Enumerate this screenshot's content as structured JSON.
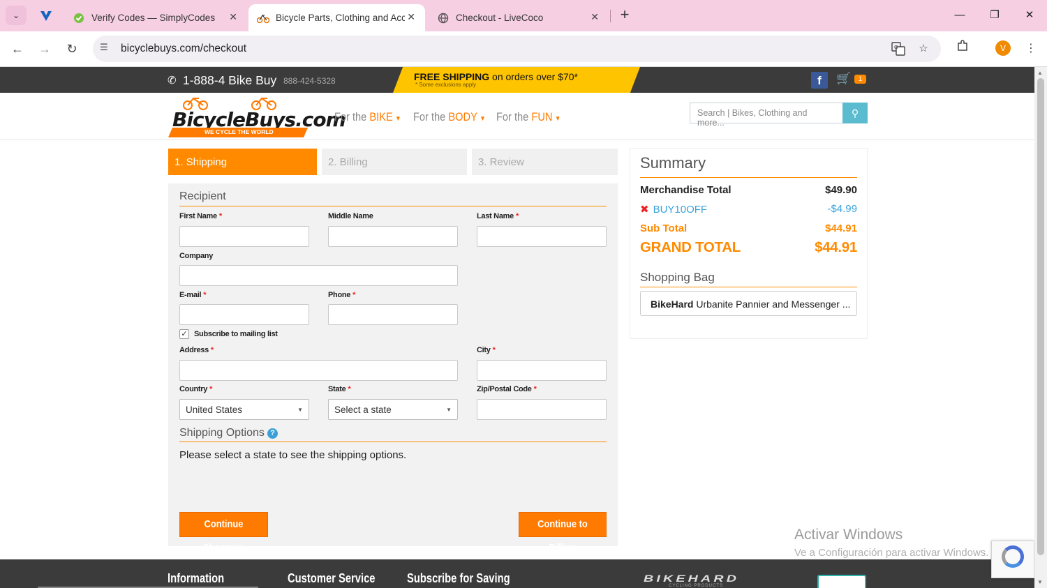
{
  "browser": {
    "tabs": [
      {
        "title": "Verify Codes — SimplyCodes",
        "active": false
      },
      {
        "title": "Bicycle Parts, Clothing and Accessories",
        "active": true
      },
      {
        "title": "Checkout - LiveCoco",
        "active": false
      }
    ],
    "url": "bicyclebuys.com/checkout",
    "profile_initial": "V"
  },
  "topbar": {
    "phone_main": "1-888-4 Bike Buy",
    "phone_sub": "888-424-5328",
    "free_shipping_bold": "FREE SHIPPING",
    "free_shipping_rest": " on orders over $70*",
    "free_shipping_note": "* Some exclusions apply",
    "cart_count": "1"
  },
  "header": {
    "logo_text": "BicycleBuys.com",
    "logo_tagline": "WE CYCLE THE WORLD",
    "nav": [
      {
        "prefix": "For the ",
        "label": "BIKE"
      },
      {
        "prefix": "For the ",
        "label": "BODY"
      },
      {
        "prefix": "For the ",
        "label": "FUN"
      }
    ],
    "search_placeholder": "Search | Bikes, Clothing and more..."
  },
  "steps": [
    "1. Shipping",
    "2. Billing",
    "3. Review"
  ],
  "form": {
    "recipient_title": "Recipient",
    "labels": {
      "first_name": "First Name",
      "middle_name": "Middle Name",
      "last_name": "Last Name",
      "company": "Company",
      "email": "E-mail",
      "phone": "Phone",
      "subscribe": "Subscribe to mailing list",
      "address": "Address",
      "city": "City",
      "country": "Country",
      "state": "State",
      "zip": "Zip/Postal Code"
    },
    "country_value": "United States",
    "state_value": "Select a state",
    "subscribe_checked": true,
    "shipping_options_title": "Shipping Options",
    "shipping_message": "Please select a state to see the shipping options.",
    "continue_shopping": "Continue Shopping",
    "continue_billing": "Continue to Billing"
  },
  "summary": {
    "title": "Summary",
    "merch_label": "Merchandise Total",
    "merch_value": "$49.90",
    "promo_code": "BUY10OFF",
    "promo_value": "-$4.99",
    "sub_label": "Sub Total",
    "sub_value": "$44.91",
    "grand_label": "GRAND TOTAL",
    "grand_value": "$44.91",
    "bag_title": "Shopping Bag",
    "bag_item_brand": "BikeHard",
    "bag_item_name": " Urbanite Pannier and Messenger ..."
  },
  "footer": {
    "headings": [
      "Information",
      "Customer Service",
      "Subscribe for Saving"
    ],
    "partner_logo": "BIKEHARD",
    "partner_sub": "CYCLING PRODUCTS"
  },
  "watermark": {
    "line1": "Activar Windows",
    "line2": "Ve a Configuración para activar Windows."
  },
  "colors": {
    "accent": "#ff8a00",
    "tabbar": "#f6cfe3",
    "topbar": "#3b3b3b",
    "promo": "#3aa3dc"
  }
}
